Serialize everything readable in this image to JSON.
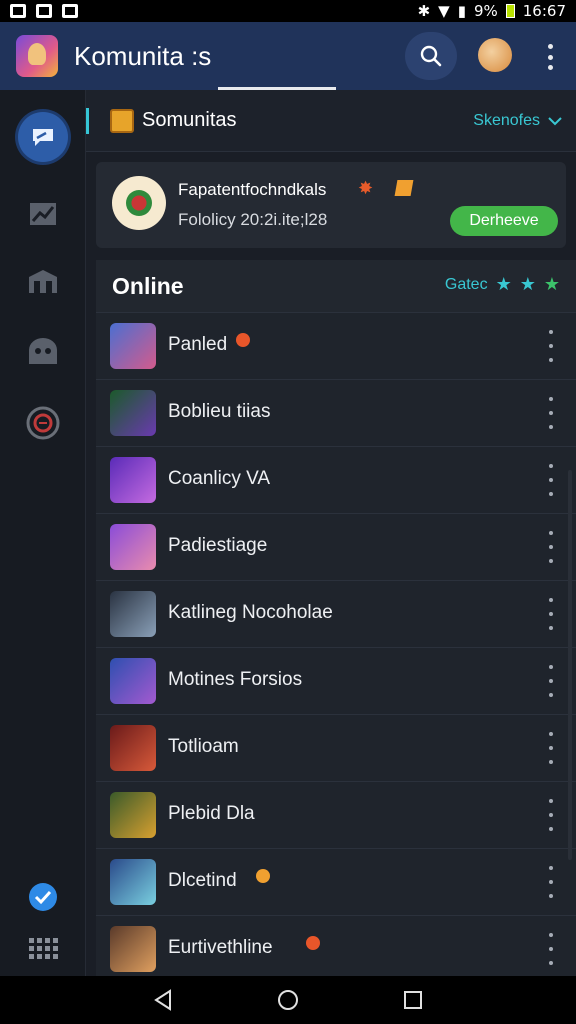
{
  "status_bar": {
    "battery": "9%",
    "time": "16:67"
  },
  "app_bar": {
    "title": "Komunita :s"
  },
  "channel": {
    "name": "Somunitas",
    "filter_label": "Skenofes"
  },
  "card": {
    "title": "Fapatentfochndkals",
    "subtitle": "Fololicy 20:2i.ite;l28",
    "button_label": "Derheeve"
  },
  "online": {
    "title": "Online",
    "filter_label": "Gatec"
  },
  "members": [
    {
      "name": "Panled",
      "colors": [
        "#4b6fd1",
        "#d45b8c"
      ],
      "badge": "#e8562a"
    },
    {
      "name": "Boblieu tiias",
      "colors": [
        "#1b5a2a",
        "#6a3ab0"
      ],
      "badge": ""
    },
    {
      "name": "Coanlicy VA",
      "colors": [
        "#5a2bb8",
        "#c56be0"
      ],
      "badge": ""
    },
    {
      "name": "Padiestiage",
      "colors": [
        "#8a4cd8",
        "#e98cae"
      ],
      "badge": ""
    },
    {
      "name": "Katlineg Nocoholae",
      "colors": [
        "#2a3342",
        "#8aa0b8"
      ],
      "badge": ""
    },
    {
      "name": "Motines Forsios",
      "colors": [
        "#2e4fb0",
        "#a45ad0"
      ],
      "badge": ""
    },
    {
      "name": "Totlioam",
      "colors": [
        "#6a1a1a",
        "#d85a3a"
      ],
      "badge": ""
    },
    {
      "name": "Plebid Dla",
      "colors": [
        "#3a5a2a",
        "#d8a030"
      ],
      "badge": ""
    },
    {
      "name": "Dlcetind",
      "colors": [
        "#2a4a8a",
        "#7ad0e0"
      ],
      "badge": "#f0a030"
    },
    {
      "name": "Eurtivethline",
      "colors": [
        "#5a3a2a",
        "#e0a060"
      ],
      "badge": "#e8562a"
    }
  ]
}
